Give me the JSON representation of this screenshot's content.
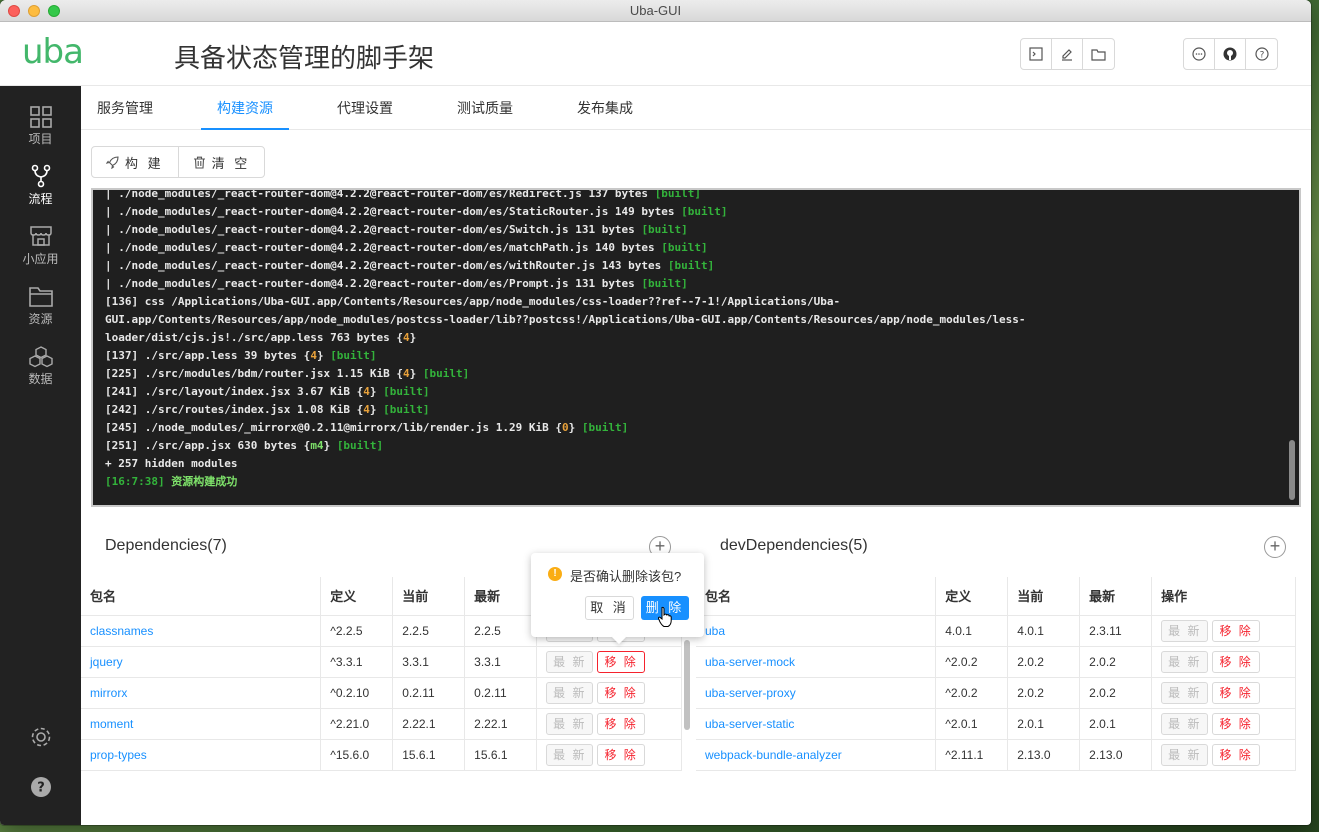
{
  "window": {
    "title": "Uba-GUI"
  },
  "header": {
    "logo": "uba",
    "title": "具备状态管理的脚手架",
    "left_icons": [
      "terminal-icon",
      "edit-icon",
      "folder-icon"
    ],
    "right_icons": [
      "chat-icon",
      "github-icon",
      "help-icon"
    ]
  },
  "sidebar": {
    "items": [
      {
        "label": "项目",
        "icon": "grid-icon"
      },
      {
        "label": "流程",
        "icon": "branch-icon"
      },
      {
        "label": "小应用",
        "icon": "store-icon"
      },
      {
        "label": "资源",
        "icon": "folder-icon"
      },
      {
        "label": "数据",
        "icon": "cubes-icon"
      }
    ],
    "bottom": [
      "settings-icon",
      "help-icon"
    ]
  },
  "tabs": [
    {
      "label": "服务管理"
    },
    {
      "label": "构建资源"
    },
    {
      "label": "代理设置"
    },
    {
      "label": "测试质量"
    },
    {
      "label": "发布集成"
    }
  ],
  "toolbar": {
    "build_label": "构 建",
    "clear_label": "清 空"
  },
  "console": {
    "lines": [
      {
        "t": "| ./node_modules/_react-router-dom@4.2.2@react-router-dom/es/Redirect.js 137 bytes ",
        "s": "[built]"
      },
      {
        "t": "| ./node_modules/_react-router-dom@4.2.2@react-router-dom/es/StaticRouter.js 149 bytes ",
        "s": "[built]"
      },
      {
        "t": "| ./node_modules/_react-router-dom@4.2.2@react-router-dom/es/Switch.js 131 bytes ",
        "s": "[built]"
      },
      {
        "t": "| ./node_modules/_react-router-dom@4.2.2@react-router-dom/es/matchPath.js 140 bytes ",
        "s": "[built]"
      },
      {
        "t": "| ./node_modules/_react-router-dom@4.2.2@react-router-dom/es/withRouter.js 143 bytes ",
        "s": "[built]"
      },
      {
        "t": "| ./node_modules/_react-router-dom@4.2.2@react-router-dom/es/Prompt.js 131 bytes ",
        "s": "[built]"
      },
      {
        "t": "[136] css /Applications/Uba-GUI.app/Contents/Resources/app/node_modules/css-loader??ref--7-1!/Applications/Uba-"
      },
      {
        "t": "GUI.app/Contents/Resources/app/node_modules/postcss-loader/lib??postcss!/Applications/Uba-GUI.app/Contents/Resources/app/node_modules/less-"
      },
      {
        "t": "loader/dist/cjs.js!./src/app.less 763 bytes {",
        "c": "4",
        "e": "}"
      },
      {
        "t": "[137] ./src/app.less 39 bytes {",
        "c": "4",
        "e": "} ",
        "s": "[built]"
      },
      {
        "t": "[225] ./src/modules/bdm/router.jsx 1.15 KiB {",
        "c": "4",
        "e": "} ",
        "s": "[built]"
      },
      {
        "t": "[241] ./src/layout/index.jsx 3.67 KiB {",
        "c": "4",
        "e": "} ",
        "s": "[built]"
      },
      {
        "t": "[242] ./src/routes/index.jsx 1.08 KiB {",
        "c": "4",
        "e": "} ",
        "s": "[built]"
      },
      {
        "t": "[245] ./node_modules/_mirrorx@0.2.11@mirrorx/lib/render.js 1.29 KiB {",
        "c": "0",
        "e": "} ",
        "s": "[built]"
      },
      {
        "t": "[251] ./src/app.jsx 630 bytes {",
        "c2": "m4",
        "e": "} ",
        "s": "[built]"
      },
      {
        "t": "+ 257 hidden modules"
      },
      {
        "ts": "[16:7:38] ",
        "ok": "资源构建成功"
      }
    ]
  },
  "deps": {
    "title": "Dependencies(7)",
    "columns": [
      "包名",
      "定义",
      "当前",
      "最新",
      "操作"
    ],
    "rows": [
      {
        "name": "classnames",
        "def": "^2.2.5",
        "cur": "2.2.5",
        "latest": "2.2.5"
      },
      {
        "name": "jquery",
        "def": "^3.3.1",
        "cur": "3.3.1",
        "latest": "3.3.1"
      },
      {
        "name": "mirrorx",
        "def": "^0.2.10",
        "cur": "0.2.11",
        "latest": "0.2.11"
      },
      {
        "name": "moment",
        "def": "^2.21.0",
        "cur": "2.22.1",
        "latest": "2.22.1"
      },
      {
        "name": "prop-types",
        "def": "^15.6.0",
        "cur": "15.6.1",
        "latest": "15.6.1"
      }
    ]
  },
  "devdeps": {
    "title": "devDependencies(5)",
    "columns": [
      "包名",
      "定义",
      "当前",
      "最新",
      "操作"
    ],
    "rows": [
      {
        "name": "uba",
        "def": "4.0.1",
        "cur": "4.0.1",
        "latest": "2.3.11"
      },
      {
        "name": "uba-server-mock",
        "def": "^2.0.2",
        "cur": "2.0.2",
        "latest": "2.0.2"
      },
      {
        "name": "uba-server-proxy",
        "def": "^2.0.2",
        "cur": "2.0.2",
        "latest": "2.0.2"
      },
      {
        "name": "uba-server-static",
        "def": "^2.0.1",
        "cur": "2.0.1",
        "latest": "2.0.1"
      },
      {
        "name": "webpack-bundle-analyzer",
        "def": "^2.11.1",
        "cur": "2.13.0",
        "latest": "2.13.0"
      }
    ]
  },
  "actions": {
    "update": "最 新",
    "remove": "移 除"
  },
  "popconfirm": {
    "message": "是否确认删除该包?",
    "cancel": "取 消",
    "ok": "删 除"
  },
  "colors": {
    "accent": "#1890ff",
    "brand": "#43b76b",
    "danger": "#f5222d",
    "warning": "#faad14"
  }
}
